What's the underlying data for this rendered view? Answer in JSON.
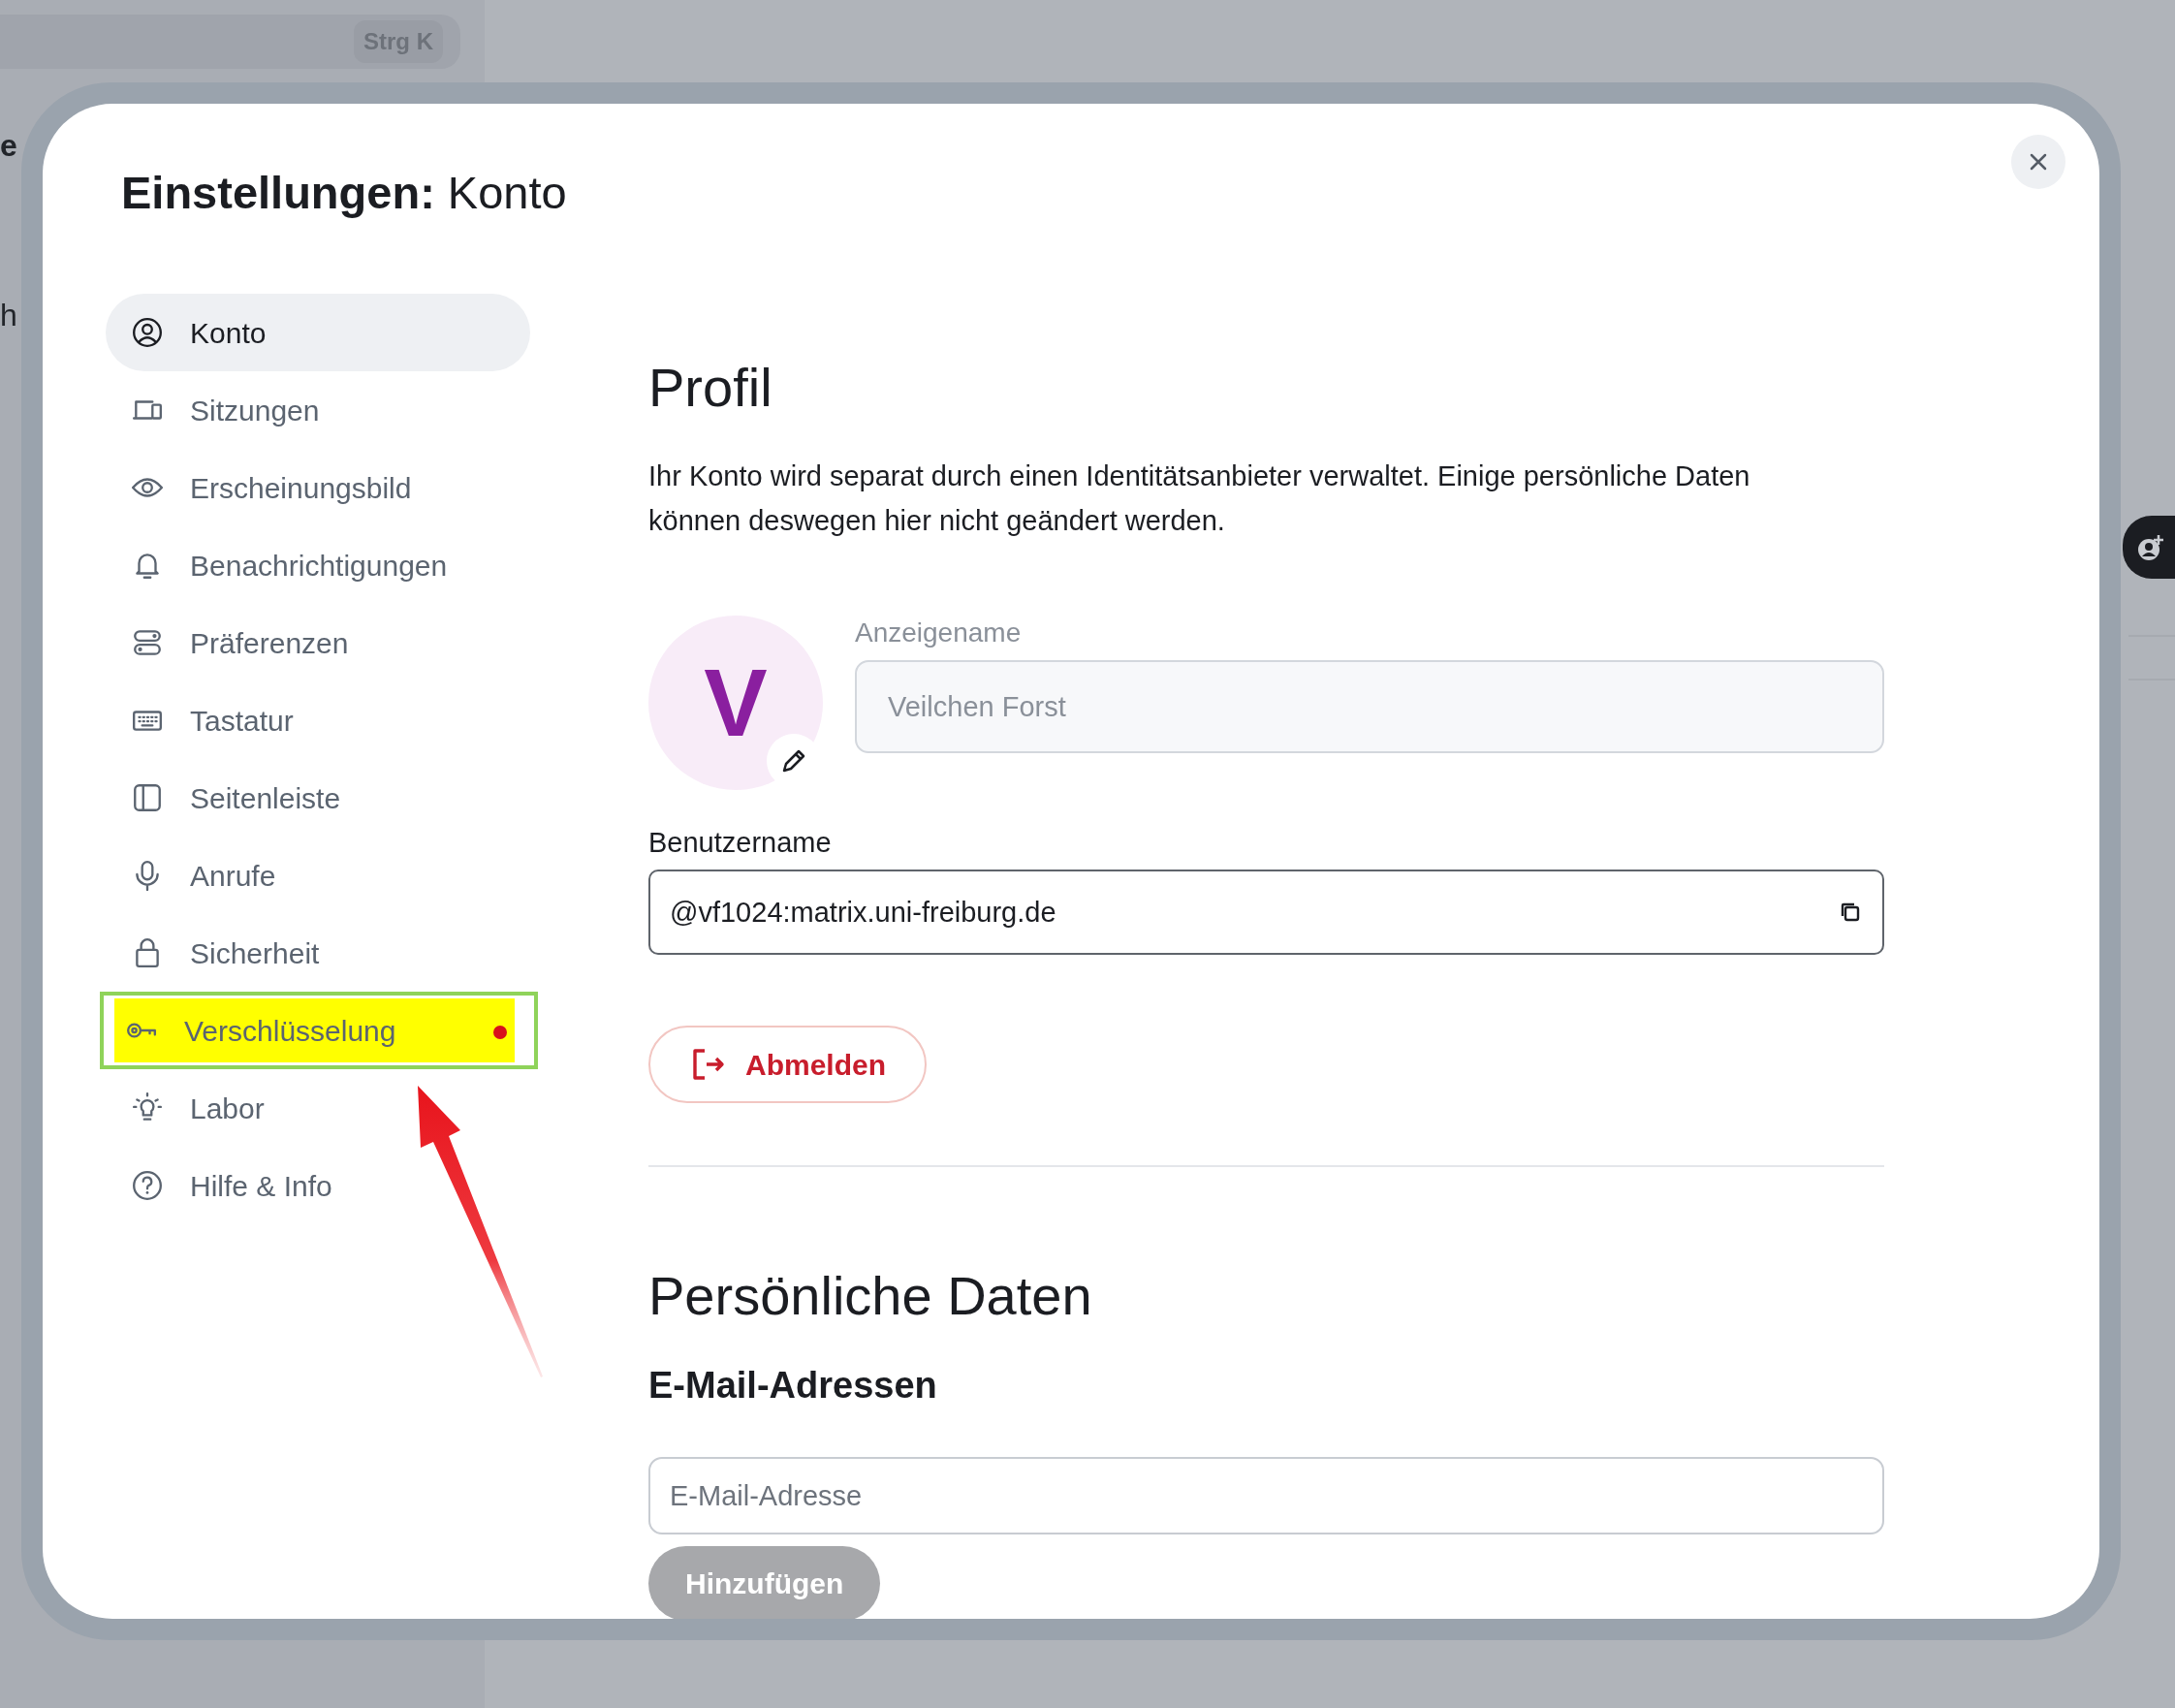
{
  "background": {
    "search_shortcut": "Strg K",
    "fragments": [
      "e",
      "h"
    ]
  },
  "dialog": {
    "title": "**Einstellungen:** Konto",
    "sidebar": {
      "items": [
        {
          "label": "Konto",
          "selected": true,
          "highlighted": false,
          "alert": false
        },
        {
          "label": "Sitzungen",
          "selected": false,
          "highlighted": false,
          "alert": false
        },
        {
          "label": "Erscheinungsbild",
          "selected": false,
          "highlighted": false,
          "alert": false
        },
        {
          "label": "Benachrichtigungen",
          "selected": false,
          "highlighted": false,
          "alert": false
        },
        {
          "label": "Präferenzen",
          "selected": false,
          "highlighted": false,
          "alert": false
        },
        {
          "label": "Tastatur",
          "selected": false,
          "highlighted": false,
          "alert": false
        },
        {
          "label": "Seitenleiste",
          "selected": false,
          "highlighted": false,
          "alert": false
        },
        {
          "label": "Anrufe",
          "selected": false,
          "highlighted": false,
          "alert": false
        },
        {
          "label": "Sicherheit",
          "selected": false,
          "highlighted": false,
          "alert": false
        },
        {
          "label": "Verschlüsselung",
          "selected": false,
          "highlighted": true,
          "alert": true
        },
        {
          "label": "Labor",
          "selected": false,
          "highlighted": false,
          "alert": false
        },
        {
          "label": "Hilfe & Info",
          "selected": false,
          "highlighted": false,
          "alert": false
        }
      ]
    },
    "profile": {
      "heading": "Profil",
      "description": "Ihr Konto wird separat durch einen Identitätsanbieter verwaltet. Einige persönliche Daten können deswegen hier nicht geändert werden.",
      "avatar": {
        "initial": "V"
      },
      "display_name": {
        "label": "Anzeigename",
        "value": "Veilchen Forst",
        "disabled": true
      },
      "username": {
        "label": "Benutzername",
        "value": "@vf1024:matrix.uni-freiburg.de"
      },
      "sign_out": "Abmelden"
    },
    "personal": {
      "heading": "Persönliche Daten",
      "email": {
        "heading": "E-Mail-Adressen",
        "placeholder": "E-Mail-Adresse",
        "button": {
          "label": "Hinzufügen",
          "disabled": true
        }
      }
    },
    "annotation_arrow": true
  }
}
